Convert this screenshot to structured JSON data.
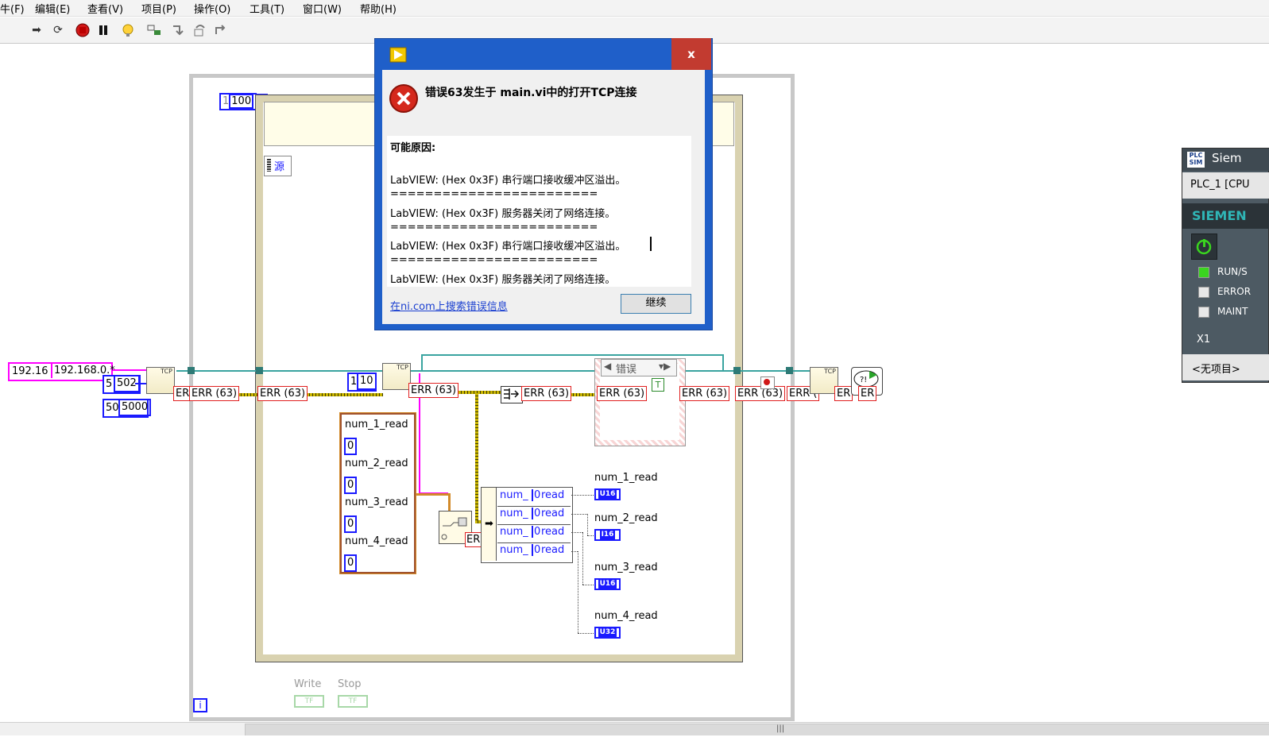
{
  "menu": {
    "items": [
      "牛(F)",
      "编辑(E)",
      "查看(V)",
      "项目(P)",
      "操作(O)",
      "工具(T)",
      "窗口(W)",
      "帮助(H)"
    ]
  },
  "toolbar": {
    "icons": [
      "run-arrow-icon",
      "run-continuously-icon",
      "abort-icon",
      "pause-icon",
      "highlight-execution-icon",
      "retain-wire-values-icon",
      "step-into-icon",
      "step-over-icon",
      "step-out-icon"
    ]
  },
  "diagram": {
    "loop_count_label": "1",
    "loop_count_value": "100",
    "source_label": "源",
    "ip_left": "192.16",
    "ip_right": "192.168.0.*",
    "port_a_left": "5",
    "port_a_value": "502",
    "port_b_left": "50",
    "port_b_value": "5000",
    "timeout_left": "1",
    "timeout_value": "10",
    "err_labels": {
      "e1": "ER",
      "e2": "ERR (63)",
      "e3": "ERR (63)",
      "e4": "ERR (63)",
      "e5": "ERR (63)",
      "e6": "ERR (63)",
      "e7": "ERR (63)",
      "e8": "ERR (63)",
      "e9": "ERR (",
      "e10": "ER",
      "e11": "ER"
    },
    "case_selector": "错误",
    "control_cluster": [
      "num_1_read",
      "num_2_read",
      "num_3_read",
      "num_4_read"
    ],
    "control_values": [
      "0",
      "0",
      "0",
      "0"
    ],
    "unbundle_items": [
      {
        "a": "num_",
        "b": "0",
        "c": "read"
      },
      {
        "a": "num_",
        "b": "0",
        "c": "read"
      },
      {
        "a": "num_",
        "b": "0",
        "c": "read"
      },
      {
        "a": "num_",
        "b": "0",
        "c": "read"
      }
    ],
    "indicators": [
      {
        "label": "num_1_read",
        "type": "U16"
      },
      {
        "label": "num_2_read",
        "type": "I16"
      },
      {
        "label": "num_3_read",
        "type": "U16"
      },
      {
        "label": "num_4_read",
        "type": "U32"
      }
    ],
    "write_label": "Write",
    "stop_label": "Stop",
    "bool_const": "TF",
    "iteration_label": "i"
  },
  "dialog": {
    "title_icon": "labview-arrow-icon",
    "close_label": "x",
    "heading": "错误63发生于 main.vi中的打开TCP连接",
    "reason_label": "可能原因:",
    "lines": [
      "LabVIEW: (Hex 0x3F) 串行端口接收缓冲区溢出。",
      "========================",
      "LabVIEW: (Hex 0x3F) 服务器关闭了网络连接。",
      "========================",
      "LabVIEW: (Hex 0x3F) 串行端口接收缓冲区溢出。",
      "========================",
      "LabVIEW: (Hex 0x3F) 服务器关闭了网络连接。"
    ],
    "search_link": "在ni.com上搜索错误信息",
    "continue_label": "继续"
  },
  "plcsim": {
    "title": "Siem",
    "cpu": "PLC_1 [CPU",
    "brand": "SIEMEN",
    "leds": [
      {
        "label": "RUN/S",
        "color": "#3ad51f"
      },
      {
        "label": "ERROR",
        "color": "#e8e8e8"
      },
      {
        "label": "MAINT",
        "color": "#e8e8e8"
      }
    ],
    "x1": "X1",
    "project": "<无项目>"
  },
  "colors": {
    "accent": "#1f5fc9",
    "close": "#c23b30",
    "error": "#e02020",
    "wire_teal": "#3aa4a0",
    "string_wire": "#ff00ff"
  }
}
